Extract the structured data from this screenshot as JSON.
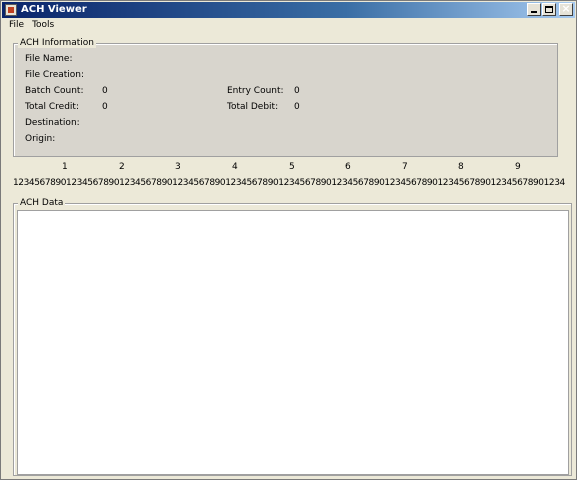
{
  "window": {
    "title": "ACH Viewer"
  },
  "menu": {
    "items": [
      "File",
      "Tools"
    ]
  },
  "ach_info": {
    "legend": "ACH Information",
    "file_name_label": "File Name:",
    "file_creation_label": "File Creation:",
    "batch_count_label": "Batch Count:",
    "batch_count_value": "0",
    "entry_count_label": "Entry Count:",
    "entry_count_value": "0",
    "total_credit_label": "Total Credit:",
    "total_credit_value": "0",
    "total_debit_label": "Total Debit:",
    "total_debit_value": "0",
    "destination_label": "Destination:",
    "origin_label": "Origin:"
  },
  "ruler": {
    "tens": [
      "1",
      "2",
      "3",
      "4",
      "5",
      "6",
      "7",
      "8",
      "9"
    ],
    "digits": "12345678901234567890123456789012345678901234567890123456789012345678901234567890123456789012345678901234"
  },
  "ach_data": {
    "legend": "ACH Data"
  }
}
